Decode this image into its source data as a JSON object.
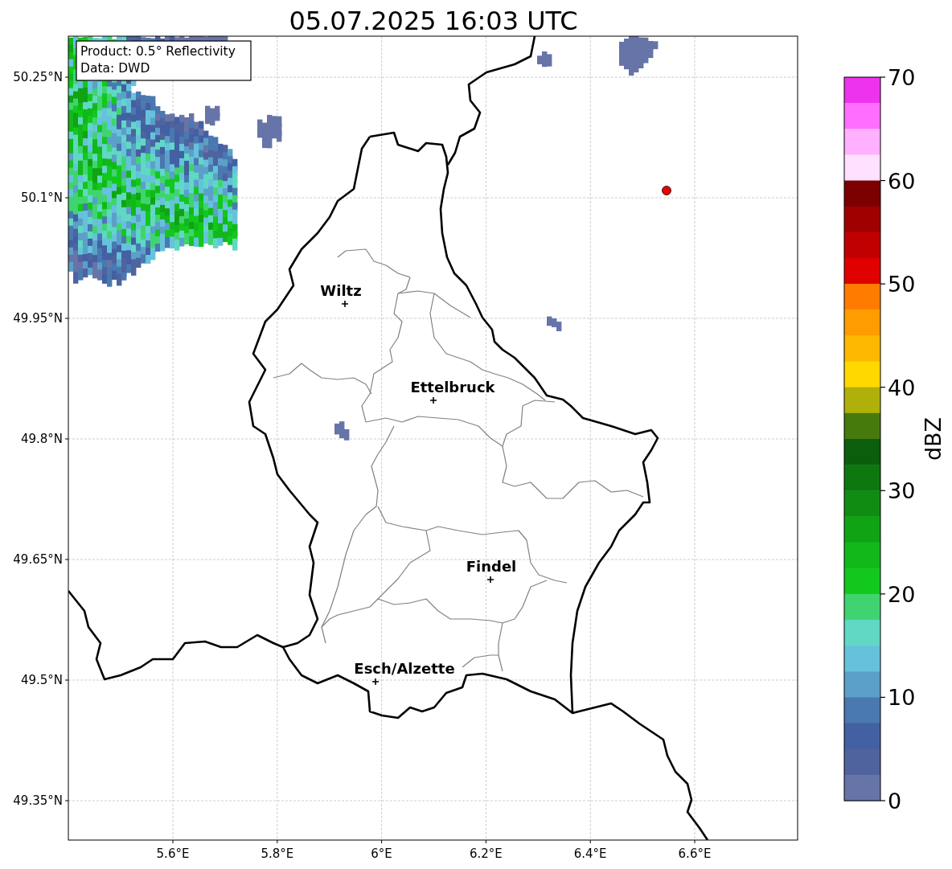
{
  "title": "05.07.2025 16:03 UTC",
  "info_box": {
    "lines": [
      "Product: 0.5° Reflectivity",
      "Data: DWD"
    ]
  },
  "lat_labels": [
    "50.25°N",
    "50.1°N",
    "49.95°N",
    "49.8°N",
    "49.65°N",
    "49.5°N",
    "49.35°N"
  ],
  "lon_labels": [
    "5.6°E",
    "5.8°E",
    "6°E",
    "6.2°E",
    "6.4°E",
    "6.6°E"
  ],
  "cities": [
    {
      "name": "Wiltz"
    },
    {
      "name": "Ettelbruck"
    },
    {
      "name": "Findel"
    },
    {
      "name": "Esch/Alzette"
    }
  ],
  "colorbar": {
    "label": "dBZ",
    "ticks": [
      "70",
      "60",
      "50",
      "40",
      "30",
      "20",
      "10",
      "0"
    ],
    "steps": [
      {
        "color": "#ee33ee"
      },
      {
        "color": "#ff6eff"
      },
      {
        "color": "#ffb0ff"
      },
      {
        "color": "#ffe0ff"
      },
      {
        "color": "#7c0000"
      },
      {
        "color": "#a00000"
      },
      {
        "color": "#c00000"
      },
      {
        "color": "#e00000"
      },
      {
        "color": "#ff7c00"
      },
      {
        "color": "#ff9c00"
      },
      {
        "color": "#ffb800"
      },
      {
        "color": "#ffd800"
      },
      {
        "color": "#b0b00a"
      },
      {
        "color": "#467a0c"
      },
      {
        "color": "#0a5e0c"
      },
      {
        "color": "#0c780e"
      },
      {
        "color": "#108c12"
      },
      {
        "color": "#10a414"
      },
      {
        "color": "#12b81a"
      },
      {
        "color": "#12c81c"
      },
      {
        "color": "#40d470"
      },
      {
        "color": "#60d8c4"
      },
      {
        "color": "#66c2dc"
      },
      {
        "color": "#5ba0c8"
      },
      {
        "color": "#4a78b0"
      },
      {
        "color": "#4260a2"
      },
      {
        "color": "#4f639e"
      },
      {
        "color": "#6674a8"
      }
    ]
  }
}
